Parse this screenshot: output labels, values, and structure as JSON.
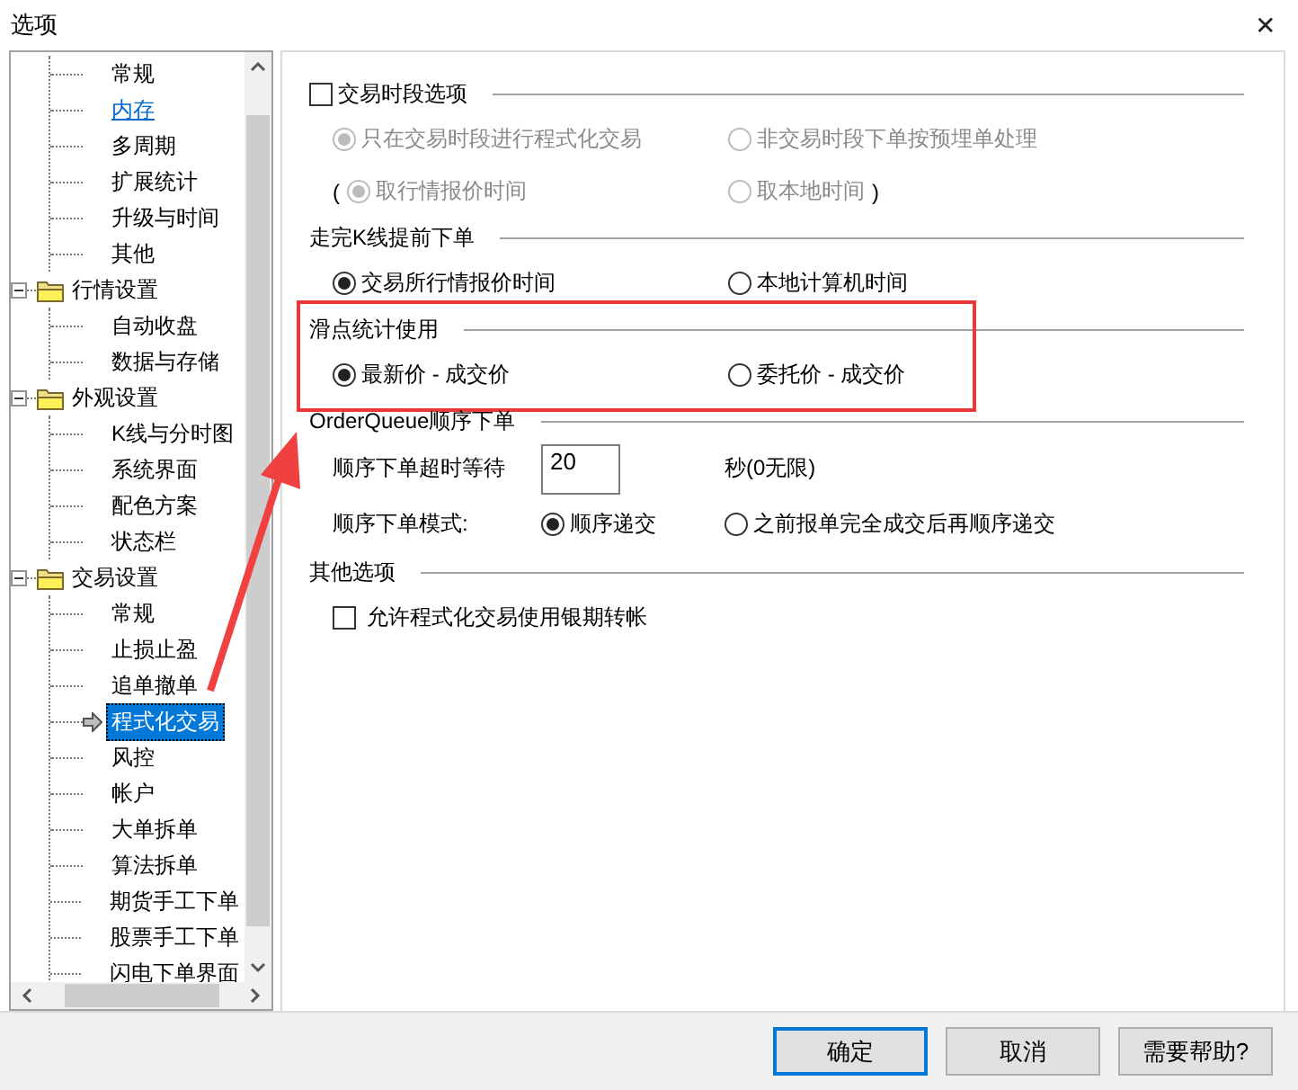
{
  "window": {
    "title": "选项",
    "close": "✕"
  },
  "tree": {
    "nodes": [
      {
        "children": [
          {
            "label": "常规",
            "selected": false,
            "hovered": false
          },
          {
            "label": "内存",
            "selected": false,
            "hovered": true
          },
          {
            "label": "多周期",
            "selected": false,
            "hovered": false
          },
          {
            "label": "扩展统计",
            "selected": false,
            "hovered": false
          },
          {
            "label": "升级与时间",
            "selected": false,
            "hovered": false
          },
          {
            "label": "其他",
            "selected": false,
            "hovered": false
          }
        ]
      },
      {
        "label": "行情设置",
        "expanded": true,
        "children": [
          {
            "label": "自动收盘",
            "selected": false,
            "hovered": false
          },
          {
            "label": "数据与存储",
            "selected": false,
            "hovered": false
          }
        ]
      },
      {
        "label": "外观设置",
        "expanded": true,
        "children": [
          {
            "label": "K线与分时图",
            "selected": false,
            "hovered": false
          },
          {
            "label": "系统界面",
            "selected": false,
            "hovered": false
          },
          {
            "label": "配色方案",
            "selected": false,
            "hovered": false
          },
          {
            "label": "状态栏",
            "selected": false,
            "hovered": false
          }
        ]
      },
      {
        "label": "交易设置",
        "expanded": true,
        "children": [
          {
            "label": "常规",
            "selected": false,
            "hovered": false
          },
          {
            "label": "止损止盈",
            "selected": false,
            "hovered": false
          },
          {
            "label": "追单撤单",
            "selected": false,
            "hovered": false
          },
          {
            "label": "程式化交易",
            "selected": true,
            "hovered": false
          },
          {
            "label": "风控",
            "selected": false,
            "hovered": false
          },
          {
            "label": "帐户",
            "selected": false,
            "hovered": false
          },
          {
            "label": "大单拆单",
            "selected": false,
            "hovered": false
          },
          {
            "label": "算法拆单",
            "selected": false,
            "hovered": false
          },
          {
            "label": "期货手工下单",
            "selected": false,
            "hovered": false
          },
          {
            "label": "股票手工下单",
            "selected": false,
            "hovered": false
          },
          {
            "label": "闪电下单界面",
            "selected": false,
            "hovered": false
          }
        ]
      }
    ]
  },
  "sections": [
    {
      "title": "交易时段选项",
      "kind": "checkbox",
      "checked": false,
      "highlighted": false,
      "rows": [
        {
          "cells": [
            [
              {
                "kind": "radio",
                "label": "只在交易时段进行程式化交易",
                "selected": true,
                "disabled": true
              }
            ],
            [
              {
                "kind": "radio",
                "label": "非交易时段下单按预埋单处理",
                "selected": false,
                "disabled": true
              }
            ]
          ]
        },
        {
          "cells": [
            [
              {
                "kind": "text",
                "label": "(",
                "disabled": false
              },
              {
                "kind": "radio",
                "label": "取行情报价时间",
                "selected": true,
                "disabled": true
              }
            ],
            [
              {
                "kind": "radio",
                "label": "取本地时间",
                "selected": false,
                "disabled": true
              },
              {
                "kind": "text",
                "label": ")",
                "disabled": false
              }
            ]
          ]
        }
      ]
    },
    {
      "title": "走完K线提前下单",
      "kind": "plain",
      "highlighted": false,
      "rows": [
        {
          "cells": [
            [
              {
                "kind": "radio",
                "label": "交易所行情报价时间",
                "selected": true,
                "disabled": false
              }
            ],
            [
              {
                "kind": "radio",
                "label": "本地计算机时间",
                "selected": false,
                "disabled": false
              }
            ]
          ]
        }
      ]
    },
    {
      "title": "滑点统计使用",
      "kind": "plain",
      "highlighted": true,
      "rows": [
        {
          "cells": [
            [
              {
                "kind": "radio",
                "label": "最新价 - 成交价",
                "selected": true,
                "disabled": false
              }
            ],
            [
              {
                "kind": "radio",
                "label": "委托价 - 成交价",
                "selected": false,
                "disabled": false
              }
            ]
          ]
        }
      ]
    },
    {
      "title": "OrderQueue顺序下单",
      "kind": "plain",
      "highlighted": false,
      "rows": [
        {
          "cells": [
            [
              {
                "kind": "text",
                "label": "顺序下单超时等待",
                "disabled": false
              }
            ],
            [
              {
                "kind": "input",
                "value": "20"
              }
            ],
            [
              {
                "kind": "text",
                "label": "秒(0无限)",
                "disabled": false
              }
            ]
          ]
        },
        {
          "cells": [
            [
              {
                "kind": "text",
                "label": "顺序下单模式:",
                "disabled": false
              }
            ],
            [
              {
                "kind": "radio",
                "label": "顺序递交",
                "selected": true,
                "disabled": false
              }
            ],
            [
              {
                "kind": "radio",
                "label": "之前报单完全成交后再顺序递交",
                "selected": false,
                "disabled": false
              }
            ]
          ]
        }
      ]
    },
    {
      "title": "其他选项",
      "kind": "plain",
      "highlighted": false,
      "rows": [
        {
          "cells": [
            [
              {
                "kind": "checkbox",
                "label": "允许程式化交易使用银期转帐",
                "checked": false
              }
            ]
          ]
        }
      ]
    }
  ],
  "buttons": [
    {
      "label": "确定",
      "default": true
    },
    {
      "label": "取消",
      "default": false
    },
    {
      "label": "需要帮助?",
      "default": false
    }
  ]
}
